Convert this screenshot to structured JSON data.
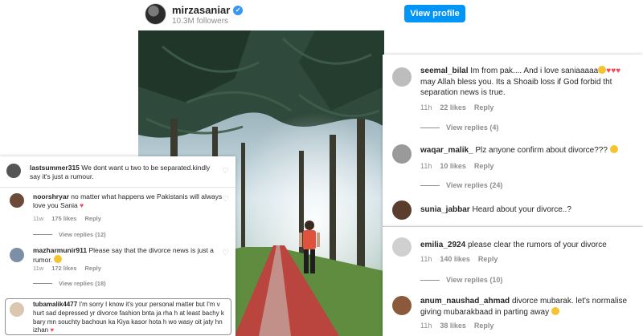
{
  "header": {
    "username": "mirzasaniar",
    "followers": "10.3M followers",
    "view_profile_label": "View profile"
  },
  "left_panel": {
    "top_comment": {
      "username": "lastsummer315",
      "text": "We dont want u two to be separated.kindly say it's just a rumour."
    },
    "comments": [
      {
        "username": "noorshryar",
        "text": "no matter what happens we Pakistanis will always love you Sania",
        "time": "11w",
        "likes": "175 likes",
        "reply": "Reply",
        "view_replies": "View replies (12)"
      },
      {
        "username": "mazharmunir911",
        "text": "Please say that the divorce news is just a rumor.",
        "time": "11w",
        "likes": "172 likes",
        "reply": "Reply",
        "view_replies": "View replies (18)"
      },
      {
        "username": "tubamalik4477",
        "text": "I'm sorry I know it's your personal matter but I'm v hurt sad depressed yr divorce fashion bnta ja rha h at least bachy k bary mn souchty bachoun ka Kiya kasor hota h wo wasy oit jaty hn izhan"
      }
    ]
  },
  "right_panel": {
    "comments": [
      {
        "username": "seemal_bilal",
        "text_a": "Im from pak.... And i love saniaaaaa",
        "text_b": " may Allah bless you. Its a Shoaib loss if God forbid tht separation news is true.",
        "time": "11h",
        "likes": "22 likes",
        "reply": "Reply",
        "view_replies": "View replies (4)"
      },
      {
        "username": "waqar_malik_",
        "text": "Plz anyone confirm about divorce???",
        "time": "11h",
        "likes": "10 likes",
        "reply": "Reply",
        "view_replies": "View replies (24)"
      },
      {
        "username": "sunia_jabbar",
        "text": "Heard about your divorce..?"
      }
    ]
  },
  "right_panel2": {
    "comments": [
      {
        "username": "emilia_2924",
        "text": "please clear the rumors of your divorce",
        "time": "11h",
        "likes": "140 likes",
        "reply": "Reply",
        "view_replies": "View replies (10)"
      },
      {
        "username": "anum_naushad_ahmad",
        "text": "divorce mubarak. let's normalise giving mubarakbaad in parting away",
        "time": "11h",
        "likes": "38 likes",
        "reply": "Reply"
      }
    ]
  },
  "colors": {
    "accent": "#0095f6",
    "verified": "#3897f0",
    "heart_red": "#ed4956",
    "muted": "#8e8e8e"
  },
  "icons": [
    "verified-icon",
    "heart-icon",
    "emoji-icon"
  ]
}
